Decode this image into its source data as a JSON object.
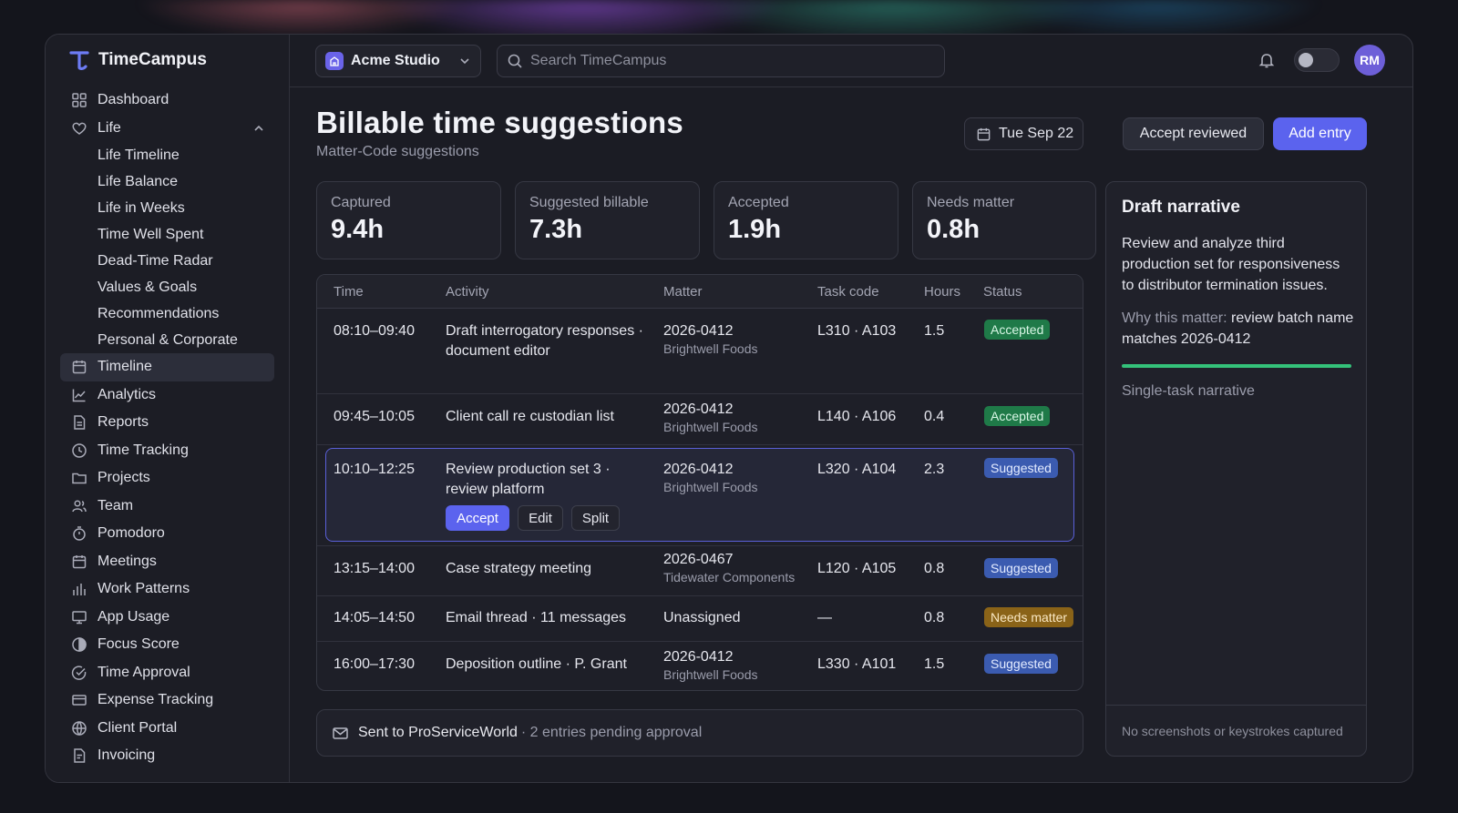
{
  "app": {
    "name": "TimeCampus"
  },
  "sidebar": {
    "items": [
      {
        "label": "Dashboard",
        "icon": "dashboard-icon"
      },
      {
        "label": "Life",
        "icon": "heart-icon",
        "expanded": true
      },
      {
        "label": "Life Timeline",
        "sub": true
      },
      {
        "label": "Life Balance",
        "sub": true
      },
      {
        "label": "Life in Weeks",
        "sub": true
      },
      {
        "label": "Time Well Spent",
        "sub": true
      },
      {
        "label": "Dead-Time Radar",
        "sub": true
      },
      {
        "label": "Values & Goals",
        "sub": true
      },
      {
        "label": "Recommendations",
        "sub": true
      },
      {
        "label": "Personal & Corporate",
        "sub": true
      },
      {
        "label": "Timeline",
        "icon": "calendar-icon",
        "active": true
      },
      {
        "label": "Analytics",
        "icon": "line-chart-icon"
      },
      {
        "label": "Reports",
        "icon": "document-icon"
      },
      {
        "label": "Time Tracking",
        "icon": "clock-icon"
      },
      {
        "label": "Projects",
        "icon": "folder-icon"
      },
      {
        "label": "Team",
        "icon": "users-icon"
      },
      {
        "label": "Pomodoro",
        "icon": "timer-icon"
      },
      {
        "label": "Meetings",
        "icon": "calendar-icon"
      },
      {
        "label": "Work Patterns",
        "icon": "bar-chart-icon"
      },
      {
        "label": "App Usage",
        "icon": "monitor-icon"
      },
      {
        "label": "Focus Score",
        "icon": "half-circle-icon"
      },
      {
        "label": "Time Approval",
        "icon": "check-circle-icon"
      },
      {
        "label": "Expense Tracking",
        "icon": "card-icon"
      },
      {
        "label": "Client Portal",
        "icon": "globe-icon"
      },
      {
        "label": "Invoicing",
        "icon": "invoice-icon"
      }
    ]
  },
  "topbar": {
    "org": "Acme Studio",
    "search_placeholder": "Search TimeCampus",
    "avatar_initials": "RM"
  },
  "header": {
    "title": "Billable time suggestions",
    "subtitle": "Matter-Code suggestions",
    "date": "Tue Sep 22",
    "accept_reviewed": "Accept reviewed",
    "add_entry": "Add entry"
  },
  "stats": [
    {
      "label": "Captured",
      "value": "9.4h"
    },
    {
      "label": "Suggested billable",
      "value": "7.3h"
    },
    {
      "label": "Accepted",
      "value": "1.9h"
    },
    {
      "label": "Needs matter",
      "value": "0.8h"
    }
  ],
  "table": {
    "headers": {
      "time": "Time",
      "activity": "Activity",
      "matter": "Matter",
      "task": "Task code",
      "hours": "Hours",
      "status": "Status"
    },
    "rows": [
      {
        "time": "08:10–09:40",
        "activity_1": "Draft interrogatory responses ·",
        "activity_2": "document editor",
        "matter": "2026-0412",
        "client": "Brightwell Foods",
        "task": "L310 · A103",
        "hours": "1.5",
        "status": "Accepted"
      },
      {
        "time": "09:45–10:05",
        "activity_1": "Client call re custodian list",
        "activity_2": "",
        "matter": "2026-0412",
        "client": "Brightwell Foods",
        "task": "L140 · A106",
        "hours": "0.4",
        "status": "Accepted"
      },
      {
        "time": "10:10–12:25",
        "activity_1": "Review production set 3 ·",
        "activity_2": "review platform",
        "matter": "2026-0412",
        "client": "Brightwell Foods",
        "task": "L320 · A104",
        "hours": "2.3",
        "status": "Suggested"
      },
      {
        "time": "13:15–14:00",
        "activity_1": "Case strategy meeting",
        "activity_2": "",
        "matter": "2026-0467",
        "client": "Tidewater Components",
        "task": "L120 · A105",
        "hours": "0.8",
        "status": "Suggested"
      },
      {
        "time": "14:05–14:50",
        "activity_1": "Email thread · 11 messages",
        "activity_2": "",
        "matter": "Unassigned",
        "client": "",
        "task": "—",
        "hours": "0.8",
        "status": "Needs matter"
      },
      {
        "time": "16:00–17:30",
        "activity_1": "Deposition outline · P. Grant",
        "activity_2": "",
        "matter": "2026-0412",
        "client": "Brightwell Foods",
        "task": "L330 · A101",
        "hours": "1.5",
        "status": "Suggested"
      }
    ],
    "row_actions": {
      "accept": "Accept",
      "edit": "Edit",
      "split": "Split"
    }
  },
  "footer": {
    "sent_to": "Sent to ProServiceWorld",
    "pending": "· 2 entries pending approval"
  },
  "panel": {
    "title": "Draft narrative",
    "body": "Review and analyze third production set for responsiveness to distributor termination issues.",
    "why_label": "Why this matter:",
    "why_text": "review batch name matches 2026-0412",
    "mode": "Single-task narrative",
    "footnote": "No screenshots or keystrokes captured"
  },
  "colors": {
    "accent": "#5b63ee",
    "accepted": "#1f7a48",
    "suggested": "#3b5bb0",
    "needs_matter": "#8a6318",
    "confidence_bar": "#34c27a"
  }
}
